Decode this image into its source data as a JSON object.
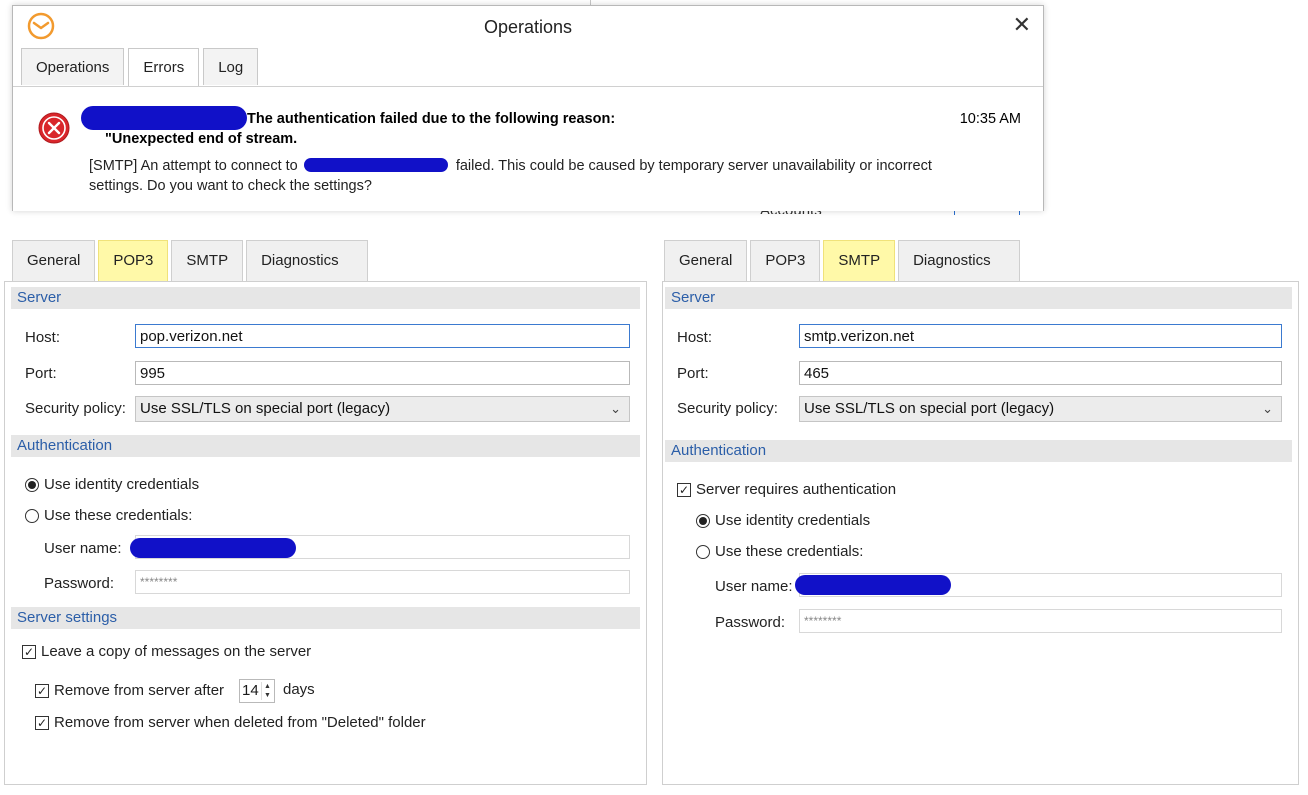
{
  "background": {
    "peek_title": "Accounts"
  },
  "ops": {
    "title": "Operations",
    "close_glyph": "✕",
    "tabs": [
      "Operations",
      "Errors",
      "Log"
    ],
    "error": {
      "headline": "The authentication failed due to the following reason:",
      "reason": "\"Unexpected end of stream.",
      "time": "10:35 AM",
      "body_prefix": "[SMTP] An attempt to connect to",
      "body_suffix": "failed. This could be caused by temporary server unavailability or incorrect settings. Do you want to check the settings?"
    }
  },
  "pop3_panel": {
    "tabs": [
      "General",
      "POP3",
      "SMTP",
      "Diagnostics"
    ],
    "server_header": "Server",
    "host_label": "Host:",
    "host_value": "pop.verizon.net",
    "port_label": "Port:",
    "port_value": "995",
    "security_label": "Security policy:",
    "security_value": "Use SSL/TLS on special port (legacy)",
    "auth_header": "Authentication",
    "radio_identity": "Use identity credentials",
    "radio_these": "Use these credentials:",
    "username_label": "User name:",
    "password_label": "Password:",
    "password_value": "********",
    "server_settings_header": "Server settings",
    "leave_copy": "Leave a copy of messages on the server",
    "remove_after": "Remove from server after",
    "remove_after_days": "14",
    "days_label": "days",
    "remove_deleted": "Remove from server when deleted from \"Deleted\" folder"
  },
  "smtp_panel": {
    "tabs": [
      "General",
      "POP3",
      "SMTP",
      "Diagnostics"
    ],
    "server_header": "Server",
    "host_label": "Host:",
    "host_value": "smtp.verizon.net",
    "port_label": "Port:",
    "port_value": "465",
    "security_label": "Security policy:",
    "security_value": "Use SSL/TLS on special port (legacy)",
    "auth_header": "Authentication",
    "server_requires_auth": "Server requires authentication",
    "radio_identity": "Use identity credentials",
    "radio_these": "Use these credentials:",
    "username_label": "User name:",
    "password_label": "Password:",
    "password_value": "********"
  },
  "colors": {
    "highlight_tab": "#fff9a8",
    "section_text": "#2b5ea8",
    "redaction": "#1111c8",
    "error_red": "#d9262b"
  }
}
